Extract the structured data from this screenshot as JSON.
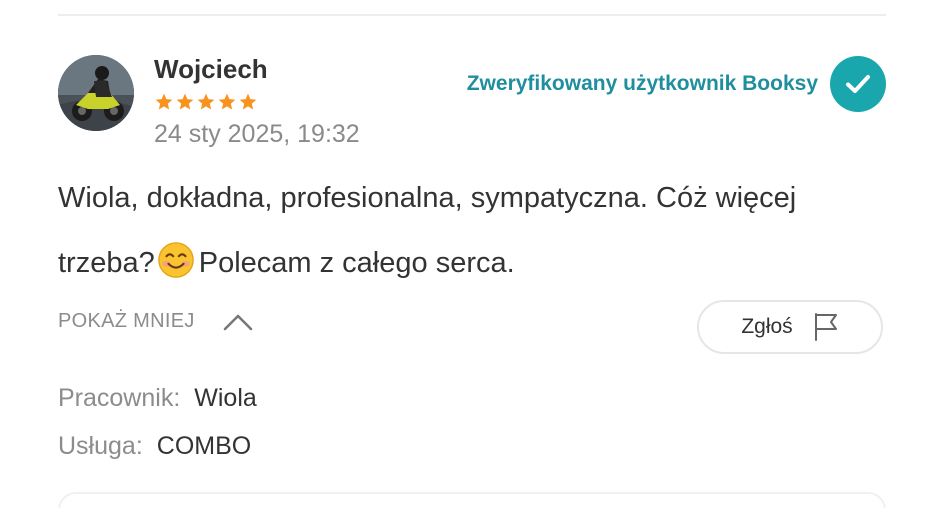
{
  "review": {
    "author": "Wojciech",
    "rating": 5,
    "rating_max": 5,
    "date": "24 sty 2025, 19:32",
    "verified_label": "Zweryfikowany użytkownik Booksy",
    "text_part1": "Wiola, dokładna, profesionalna, sympatyczna. Cóż więcej trzeba?",
    "text_part2": "Polecam z całego serca.",
    "emoji_icon": "smiling-face-icon"
  },
  "actions": {
    "show_less_label": "POKAŻ MNIEJ",
    "report_label": "Zgłoś"
  },
  "details": {
    "worker_label": "Pracownik:",
    "worker_value": "Wiola",
    "service_label": "Usługa:",
    "service_value": "COMBO"
  },
  "colors": {
    "accent": "#1aa6ad",
    "accent_text": "#1f8f9e",
    "star": "#f7931e",
    "muted_text": "#8c8c8c"
  }
}
